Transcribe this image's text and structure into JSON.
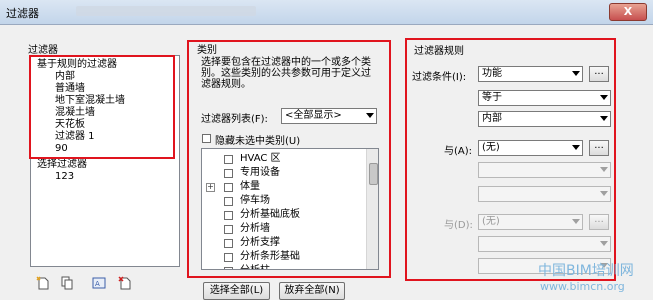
{
  "window": {
    "title": "过滤器",
    "close_label": "X"
  },
  "filters_panel": {
    "heading": "过滤器",
    "group_rule_based": "基于规则的过滤器",
    "rule_items": [
      "内部",
      "普通墙",
      "地下室混凝土墙",
      "混凝土墙",
      "天花板",
      "过滤器 1",
      "90"
    ],
    "group_selection": "选择过滤器",
    "selection_items": [
      "123"
    ]
  },
  "categories_panel": {
    "heading": "类别",
    "description": "选择要包含在过滤器中的一个或多个类别。这些类别的公共参数可用于定义过滤器规则。",
    "filter_list_label": "过滤器列表(F):",
    "filter_list_value": "<全部显示>",
    "hide_unchecked_label": "隐藏未选中类别(U)",
    "categories": [
      {
        "label": "HVAC 区",
        "expander": false
      },
      {
        "label": "专用设备",
        "expander": false
      },
      {
        "label": "体量",
        "expander": true
      },
      {
        "label": "停车场",
        "expander": false
      },
      {
        "label": "分析基础底板",
        "expander": false
      },
      {
        "label": "分析墙",
        "expander": false
      },
      {
        "label": "分析支撑",
        "expander": false
      },
      {
        "label": "分析条形基础",
        "expander": false
      },
      {
        "label": "分析柱",
        "expander": false
      }
    ],
    "select_all": "选择全部(L)",
    "deselect_all": "放弃全部(N)"
  },
  "rules_panel": {
    "heading": "过滤器规则",
    "condition_label": "过滤条件(I):",
    "condition_value": "功能",
    "operator_value": "等于",
    "value_value": "内部",
    "and1_label": "与(A):",
    "and1_value": "(无)",
    "and2_label": "与(D):",
    "and2_value": "(无)",
    "ellipsis": "..."
  },
  "watermark": {
    "cn": "中国BIM培训网",
    "url": "www.bimcn.org"
  },
  "colors": {
    "highlight": "#e0141e",
    "watermark": "#7fb6dd"
  }
}
